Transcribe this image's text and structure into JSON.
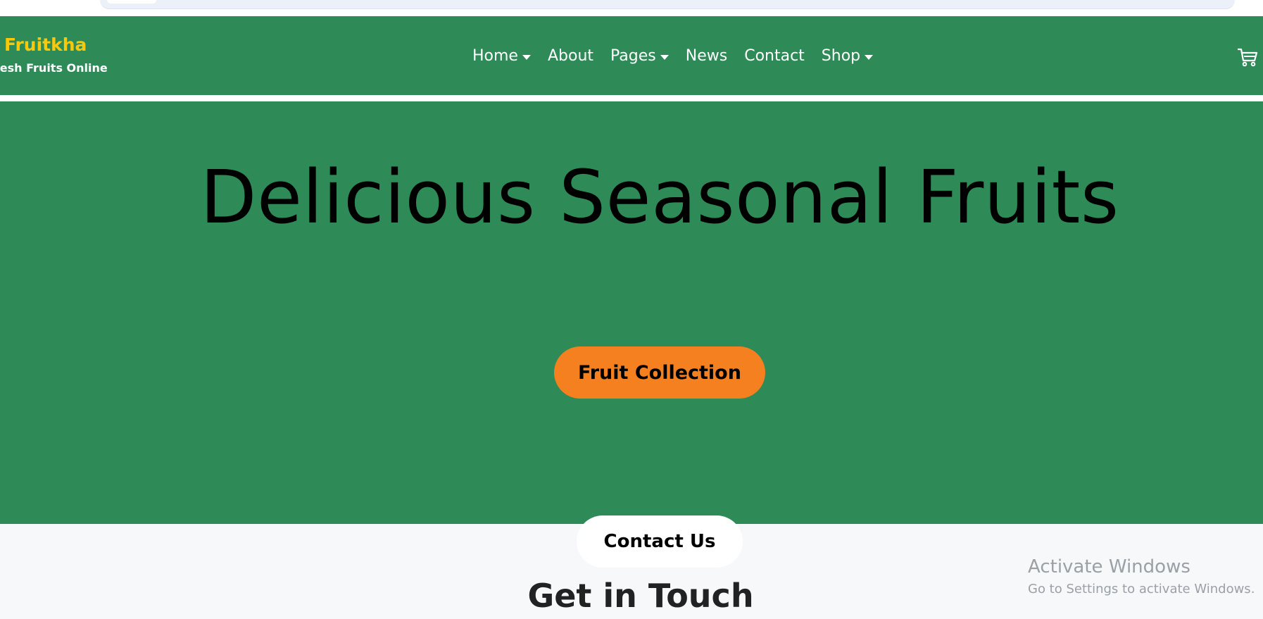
{
  "brand": {
    "name": "Fruitkha",
    "tagline": "Fresh Fruits Online"
  },
  "nav": {
    "items": [
      {
        "label": "Home",
        "has_dropdown": true
      },
      {
        "label": "About",
        "has_dropdown": false
      },
      {
        "label": "Pages",
        "has_dropdown": true
      },
      {
        "label": "News",
        "has_dropdown": false
      },
      {
        "label": "Contact",
        "has_dropdown": false
      },
      {
        "label": "Shop",
        "has_dropdown": true
      }
    ],
    "cart_icon": "shopping-cart-icon"
  },
  "hero": {
    "title": "Delicious Seasonal Fruits",
    "button_label": "Fruit Collection"
  },
  "contact": {
    "pill_label": "Contact Us",
    "heading": "Get in Touch"
  },
  "watermark": {
    "title": "Activate Windows",
    "subtitle": "Go to Settings to activate Windows."
  },
  "colors": {
    "primary_green": "#2e8b57",
    "brand_yellow": "#f7c90a",
    "accent_orange": "#f4801f",
    "section_bg": "#f7f8fa"
  }
}
